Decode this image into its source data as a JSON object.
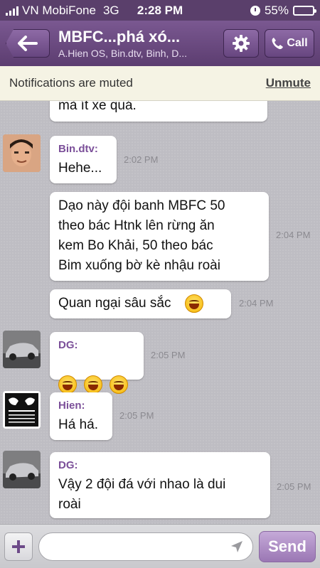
{
  "status_bar": {
    "carrier": "VN MobiFone",
    "network": "3G",
    "time": "2:28 PM",
    "battery_percent": "55%",
    "battery_level": 0.55,
    "signal_icon": "signal-bars-icon",
    "alarm_icon": "clock-icon"
  },
  "header": {
    "title": "MBFC...phá xó...",
    "subtitle": "A.Hien OS, Bin.dtv, Binh, D...",
    "call_label": "Call",
    "back_icon": "arrow-left-icon",
    "settings_icon": "gear-icon",
    "call_icon": "phone-icon"
  },
  "banner": {
    "message": "Notifications are muted",
    "action": "Unmute"
  },
  "messages": [
    {
      "sender": "",
      "text": "mà ít xe quá.",
      "time": ""
    },
    {
      "sender": "Bin.dtv:",
      "text": "Hehe...",
      "time": "2:02 PM"
    },
    {
      "sender": "",
      "text": "Dạo này đội banh MBFC 50\ntheo bác Htnk lên rừng ăn\nkem Bo Khải, 50 theo bác\nBim xuống bờ kè nhậu roài",
      "time": "2:04 PM"
    },
    {
      "sender": "",
      "text": "Quan ngại sâu sắc",
      "time": "2:04 PM"
    },
    {
      "sender": "DG:",
      "text": "",
      "time": "2:05 PM"
    },
    {
      "sender": "Hien:",
      "text": "Há há.",
      "time": "2:05 PM"
    },
    {
      "sender": "DG:",
      "text": "Vậy 2 đội đá với nhao là dui\nroài",
      "time": "2:05 PM"
    }
  ],
  "composer": {
    "placeholder": "",
    "send_label": "Send",
    "add_icon": "plus-icon",
    "location_icon": "location-arrow-icon"
  },
  "colors": {
    "brand_purple": "#5c3d70",
    "sender_name": "#7b4f99",
    "send_button": "#9b77b4",
    "chat_background": "#bebdc3"
  }
}
